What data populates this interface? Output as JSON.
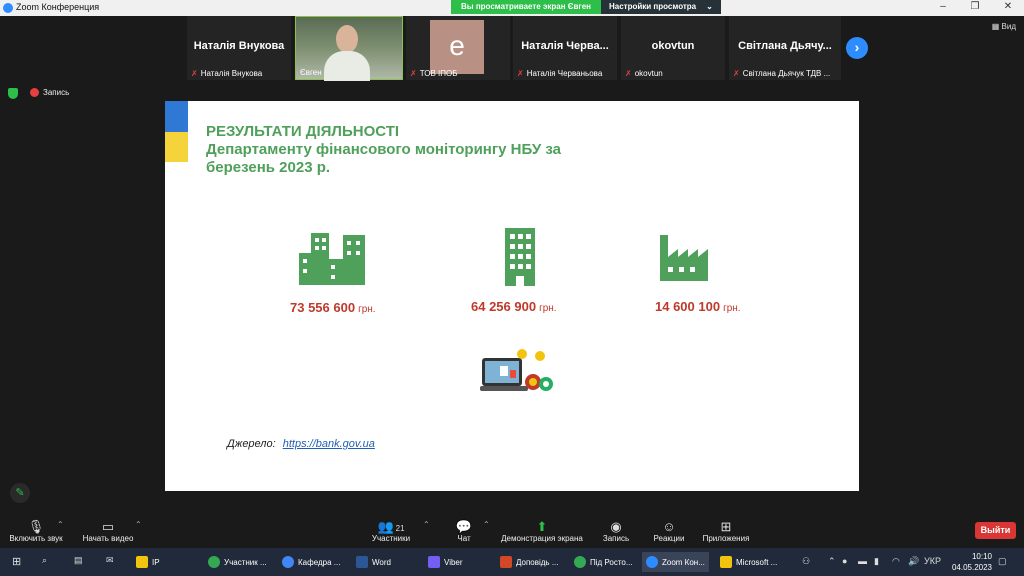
{
  "window": {
    "title": "Zoom Конференция"
  },
  "share_banner": {
    "viewing": "Вы просматриваете экран Євген",
    "settings": "Настройки просмотра"
  },
  "view_label": "Вид",
  "participants": [
    {
      "name_big": "Наталія Внукова",
      "label": "Наталія Внукова"
    },
    {
      "name_big": "",
      "label": "Євген"
    },
    {
      "name_big": "е",
      "label": "ТОВ ІПОБ"
    },
    {
      "name_big": "Наталія Черва...",
      "label": "Наталія Черваньова"
    },
    {
      "name_big": "okovtun",
      "label": "okovtun"
    },
    {
      "name_big": "Світлана Дьячу...",
      "label": "Світлана Дьячук ТДВ ..."
    }
  ],
  "recording_label": "Запись",
  "slide": {
    "title_line1": "РЕЗУЛЬТАТИ ДІЯЛЬНОСТІ",
    "title_line2": "Департаменту фінансового моніторингу НБУ за",
    "title_line3": "березень 2023 р.",
    "amounts": [
      {
        "value": "73 556 600",
        "unit": "грн."
      },
      {
        "value": "64 256 900",
        "unit": "грн."
      },
      {
        "value": "14 600 100",
        "unit": "грн."
      }
    ],
    "source_label": "Джерело:",
    "source_link": "https://bank.gov.ua"
  },
  "toolbar": {
    "audio": "Включить звук",
    "video": "Начать видео",
    "participants": "Участники",
    "participants_count": "21",
    "chat": "Чат",
    "share": "Демонстрация экрана",
    "record": "Запись",
    "reactions": "Реакции",
    "apps": "Приложения",
    "leave": "Выйти"
  },
  "taskbar": {
    "items": [
      "IP",
      "Участник ...",
      "Кафедра ...",
      "Word",
      "Viber",
      "Доповідь ...",
      "Під Росто...",
      "Zoom Кон...",
      "Microsoft ..."
    ],
    "lang": "УКР",
    "time": "10:10",
    "date": "04.05.2023"
  },
  "colors": {
    "accent": "#2d8cff",
    "slide_green": "#4fa05a",
    "amount_red": "#c0392b",
    "leave_red": "#d93636"
  }
}
